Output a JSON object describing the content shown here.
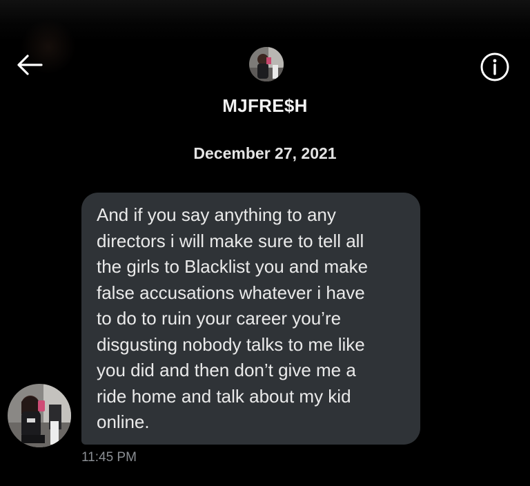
{
  "header": {
    "back_icon": "arrow-left-icon",
    "info_icon": "info-circle-icon",
    "avatar_icon": "profile-photo",
    "contact_name": "MJFRE$H"
  },
  "conversation": {
    "date": "December 27, 2021",
    "messages": [
      {
        "text": "And if you say anything to any\ndirectors i will make sure to tell all\nthe girls to Blacklist you and make\nfalse accusations whatever i have\nto do to ruin your career you’re\ndisgusting nobody talks to me like\nyou did and then don’t give me a\nride home and talk about my kid\nonline.",
        "time": "11:45 PM",
        "bubble_color": "#2f3337"
      }
    ]
  },
  "colors": {
    "background": "#000000",
    "text": "#e7e9ea",
    "timestamp": "#8b8f94"
  }
}
